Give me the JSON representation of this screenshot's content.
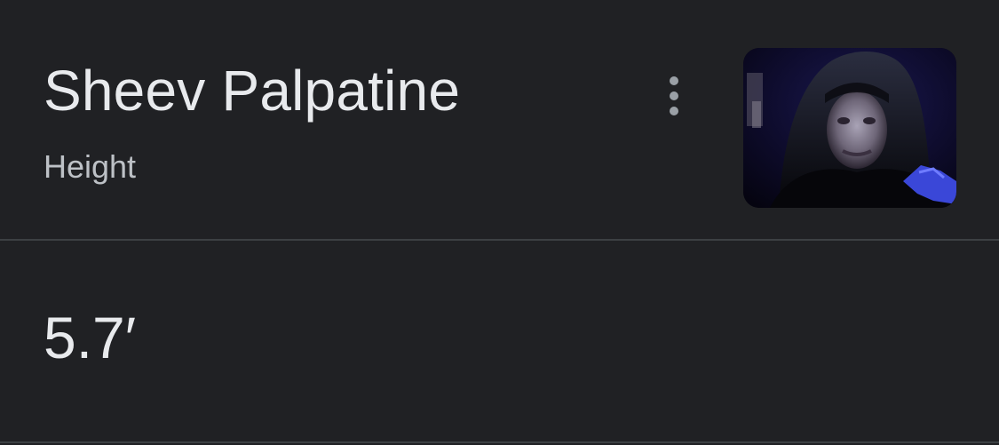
{
  "card": {
    "title": "Sheev Palpatine",
    "subtitle": "Height",
    "more_icon": "more-vertical-icon",
    "thumbnail_alt": "Sheev Palpatine",
    "value": "5.7′"
  },
  "colors": {
    "background": "#202124",
    "title_text": "#e8eaed",
    "subtitle_text": "#bdc1c6",
    "divider": "#3c4043",
    "icon": "#9aa0a6"
  }
}
